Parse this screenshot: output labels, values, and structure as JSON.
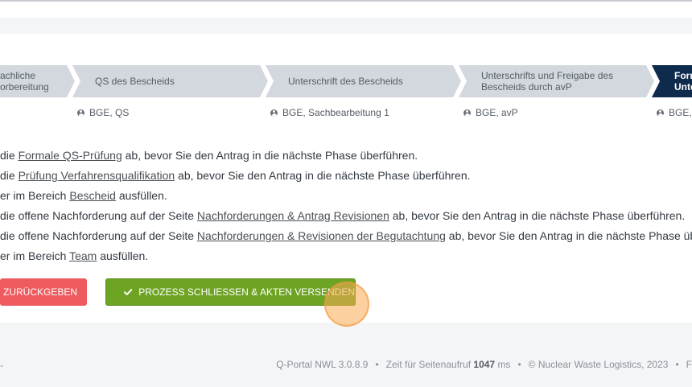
{
  "steps": [
    {
      "label": "achliche\norbereitung"
    },
    {
      "label": "QS des Bescheids"
    },
    {
      "label": "Unterschrift des Bescheids"
    },
    {
      "label": "Unterschrifts und Freigabe des\nBescheids durch avP"
    },
    {
      "label": "Form\nUnte"
    }
  ],
  "assignees": [
    {
      "label": "BGE, QS"
    },
    {
      "label": "BGE, Sachbearbeitung 1"
    },
    {
      "label": "BGE, avP"
    },
    {
      "label": "BGE,"
    }
  ],
  "messages": [
    {
      "pre": "die ",
      "link": "Formale QS-Prüfung",
      "post": " ab, bevor Sie den Antrag in die nächste Phase überführen."
    },
    {
      "pre": "die ",
      "link": "Prüfung Verfahrensqualifikation",
      "post": " ab, bevor Sie den Antrag in die nächste Phase überführen."
    },
    {
      "pre": "er im Bereich ",
      "link": "Bescheid",
      "post": " ausfüllen."
    },
    {
      "pre": "die offene Nachforderung auf der Seite ",
      "link": "Nachforderungen & Antrag Revisionen",
      "post": " ab, bevor Sie den Antrag in die nächste Phase überführen."
    },
    {
      "pre": "die offene Nachforderung auf der Seite ",
      "link": "Nachforderungen & Revisionen der Begutachtung",
      "post": " ab, bevor Sie den Antrag in die nächste Phase über"
    },
    {
      "pre": "er im Bereich ",
      "link": "Team",
      "post": " ausfüllen."
    }
  ],
  "buttons": {
    "return_label": "ZURÜCKGEBEN",
    "close_label": "PROZESS SCHLIESSEN & AKTEN VERSENDEN"
  },
  "footer": {
    "left": "-",
    "portal": "Q-Portal NWL 3.0.8.9",
    "time_prefix": "Zeit für Seitenaufruf",
    "time_value": "1047",
    "time_unit": "ms",
    "copyright": "© Nuclear Waste Logistics, 2023",
    "trailing": "F"
  },
  "colors": {
    "active_step": "#0e2a4c",
    "step": "#d3d8de",
    "return_button": "#ef5a5e",
    "close_button": "#6ea424"
  },
  "icons": [
    "user-icon",
    "check-icon"
  ]
}
